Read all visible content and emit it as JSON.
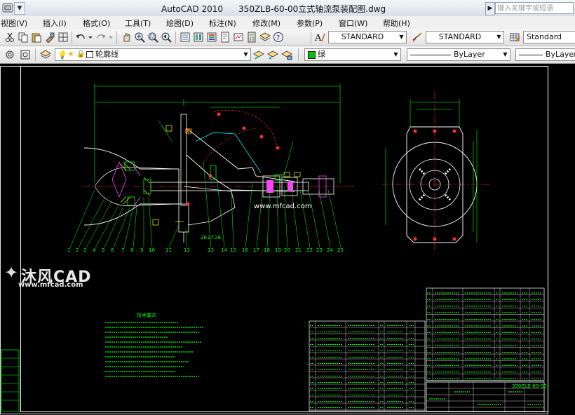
{
  "titlebar": {
    "app_name": "AutoCAD 2010",
    "file_name": "350ZLB-60-00立式轴流泵装配图.dwg",
    "search_placeholder": "键入关键字或短语"
  },
  "menu": [
    "视图(V)",
    "插入(I)",
    "格式(O)",
    "工具(T)",
    "绘图(D)",
    "标注(N)",
    "修改(M)",
    "参数(P)",
    "窗口(W)",
    "帮助(H)"
  ],
  "toolbar": {
    "text_style": "STANDARD",
    "dim_style": "STANDARD",
    "table_style": "Standard"
  },
  "layers": {
    "current_layer": "轮廓线",
    "color": "绿",
    "color_hex": "#00c000",
    "linetype": "ByLayer",
    "lineweight": "ByLayer"
  },
  "watermark": {
    "brand": "沐风CAD",
    "url": "www.mfcad.com",
    "center_url": "www.mfcad.com"
  },
  "drawing": {
    "notes_title": "技术要求",
    "title_block_code": "350ZLB-60-00",
    "part_numbers": [
      "1",
      "2",
      "3",
      "4",
      "5",
      "6",
      "7",
      "8",
      "9",
      "10",
      "11",
      "12",
      "13",
      "14",
      "15",
      "16",
      "17",
      "18",
      "19",
      "20",
      "21",
      "22",
      "23",
      "24",
      "25",
      "26",
      "27",
      "28"
    ]
  }
}
